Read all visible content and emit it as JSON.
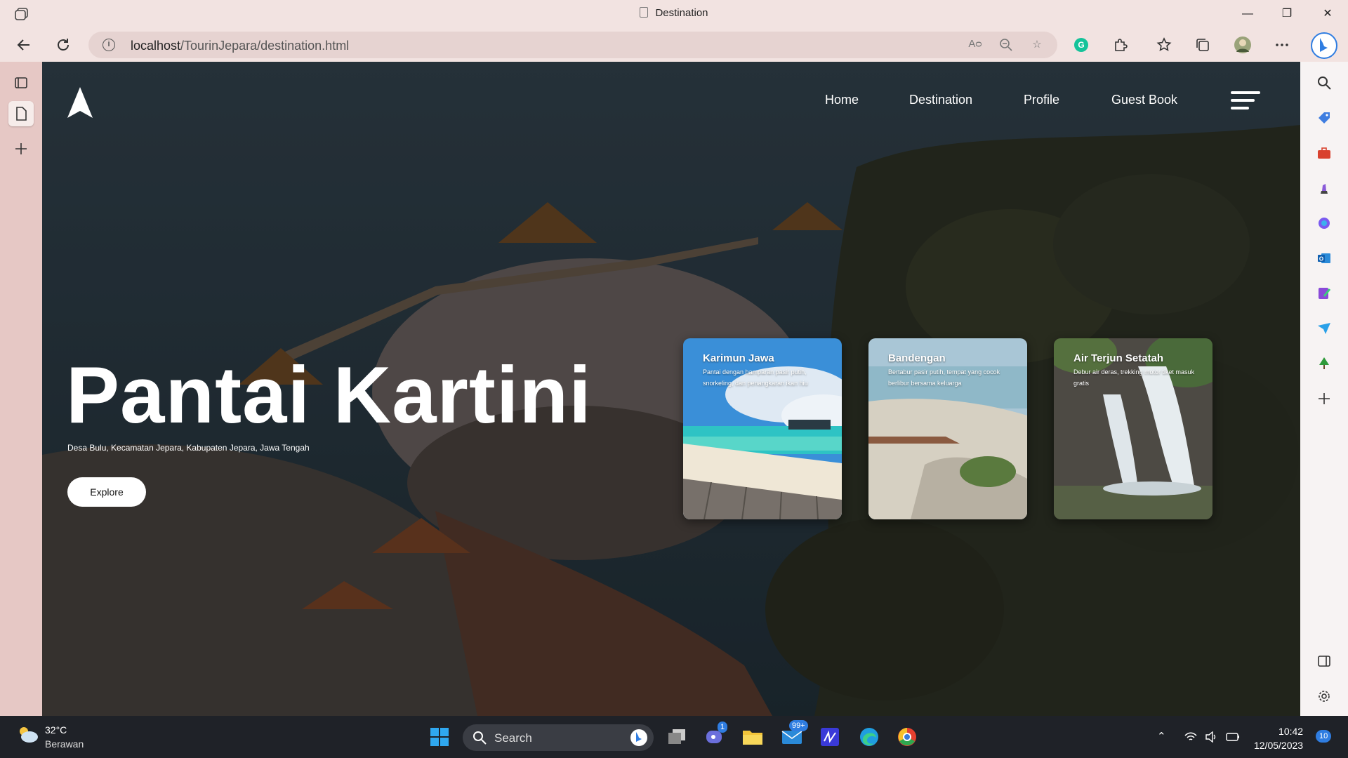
{
  "browser": {
    "tab_title": "Destination",
    "url_host": "localhost",
    "url_path": "/TourinJepara/destination.html"
  },
  "nav": {
    "items": [
      "Home",
      "Destination",
      "Profile",
      "Guest Book"
    ]
  },
  "hero": {
    "title": "Pantai Kartini",
    "subtitle": "Desa Bulu, Kecamatan Jepara, Kabupaten Jepara, Jawa Tengah",
    "button": "Explore"
  },
  "cards": [
    {
      "title": "Karimun Jawa",
      "desc": "Pantai dengan hamparan pasir putih, snorkeling, dan penangkaran ikan hiu"
    },
    {
      "title": "Bandengan",
      "desc": "Bertabur pasir putih, tempat yang cocok berlibur bersama keluarga"
    },
    {
      "title": "Air Terjun Setatah",
      "desc": "Debur air deras, trekking motor tiket masuk gratis"
    }
  ],
  "taskbar": {
    "weather_temp": "32°C",
    "weather_cond": "Berawan",
    "search": "Search",
    "teams_badge": "1",
    "mail_badge": "99+",
    "time": "10:42",
    "date": "12/05/2023",
    "notif_badge": "10"
  },
  "colors": {
    "accent": "#2f7de1",
    "chrome": "#f2e3e1",
    "sidebar": "#e6c8c5",
    "taskbar": "#1f2228"
  }
}
